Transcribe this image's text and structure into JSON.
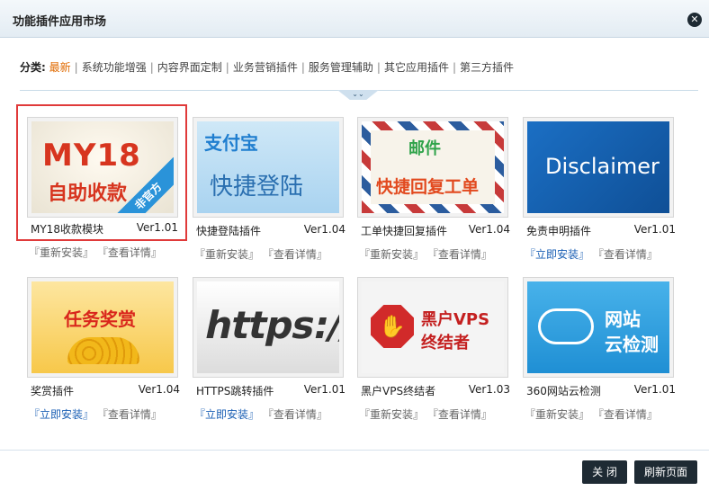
{
  "dialog": {
    "title": "功能插件应用市场",
    "close_glyph": "✕"
  },
  "categories": {
    "label": "分类:",
    "items": [
      "最新",
      "系统功能增强",
      "内容界面定制",
      "业务营销插件",
      "服务管理辅助",
      "其它应用插件",
      "第三方插件"
    ],
    "active_index": 0,
    "collapse_glyph": "⌄⌄"
  },
  "plugins": [
    {
      "name": "MY18收款模块",
      "version": "Ver1.01",
      "action1": "『重新安装』",
      "action2": "『查看详情』",
      "thumb": {
        "logo": "MY18",
        "sub": "自助收款",
        "ribbon": "非官方"
      }
    },
    {
      "name": "快捷登陆插件",
      "version": "Ver1.04",
      "action1": "『重新安装』",
      "action2": "『查看详情』",
      "thumb": {
        "logo": "支付宝",
        "sub": "快捷登陆"
      }
    },
    {
      "name": "工单快捷回复插件",
      "version": "Ver1.04",
      "action1": "『重新安装』",
      "action2": "『查看详情』",
      "thumb": {
        "logo": "邮件",
        "sub": "快捷回复工单"
      }
    },
    {
      "name": "免责申明插件",
      "version": "Ver1.01",
      "action1": "『立即安装』",
      "action2": "『查看详情』",
      "thumb": {
        "logo": "Disclaimer"
      }
    },
    {
      "name": "奖赏插件",
      "version": "Ver1.04",
      "action1": "『立即安装』",
      "action2": "『查看详情』",
      "thumb": {
        "logo": "任务奖赏"
      }
    },
    {
      "name": "HTTPS跳转插件",
      "version": "Ver1.01",
      "action1": "『立即安装』",
      "action2": "『查看详情』",
      "thumb": {
        "logo": "https://www."
      }
    },
    {
      "name": "黑户VPS终结者",
      "version": "Ver1.03",
      "action1": "『重新安装』",
      "action2": "『查看详情』",
      "thumb": {
        "logo": "黑户VPS",
        "sub": "终结者"
      }
    },
    {
      "name": "360网站云检测",
      "version": "Ver1.01",
      "action1": "『重新安装』",
      "action2": "『查看详情』",
      "thumb": {
        "logo": "网站",
        "sub": "云检测"
      }
    }
  ],
  "footer": {
    "close_label": "关 闭",
    "refresh_label": "刷新页面"
  }
}
